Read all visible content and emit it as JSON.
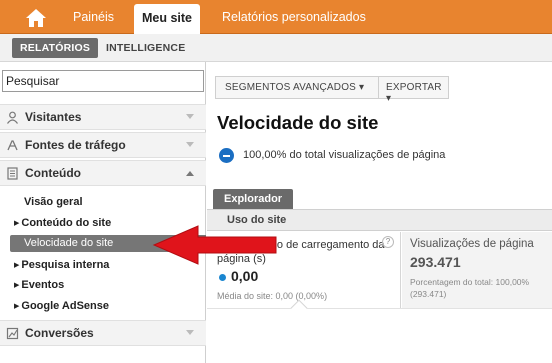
{
  "topbar": {
    "tabs": [
      "Painéis",
      "Meu site",
      "Relatórios personalizados"
    ],
    "active_tab": "Meu site"
  },
  "subbar": {
    "buttons": [
      "RELATÓRIOS",
      "INTELLIGENCE"
    ]
  },
  "sidebar": {
    "search_value": "Pesquisar",
    "sections": {
      "visitantes": "Visitantes",
      "fontes": "Fontes de tráfego",
      "conteudo": "Conteúdo",
      "conversoes": "Conversões"
    },
    "conteudo_items": [
      "Visão geral",
      "Conteúdo do site",
      "Velocidade do site",
      "Pesquisa interna",
      "Eventos",
      "Google AdSense"
    ]
  },
  "main": {
    "toolbar": {
      "segments": "SEGMENTOS AVANÇADOS",
      "export": "EXPORTAR"
    },
    "title": "Velocidade do site",
    "summary": "100,00% do total visualizações de página",
    "explorer_tab": "Explorador",
    "usage_label": "Uso do site",
    "metric_load": {
      "label": "Tempo médio de carregamento da página (s)",
      "value": "0,00",
      "avg": "Média do site: 0,00 (0,00%)"
    },
    "metric_views": {
      "label": "Visualizações de página",
      "value": "293.471",
      "pct": "Porcentagem do total: 100,00%",
      "total": "(293.471)"
    }
  },
  "colors": {
    "brand_orange": "#e8842f",
    "selection_gray": "#767676",
    "accent_blue": "#1b6ec2",
    "arrow_red": "#e0141b"
  }
}
